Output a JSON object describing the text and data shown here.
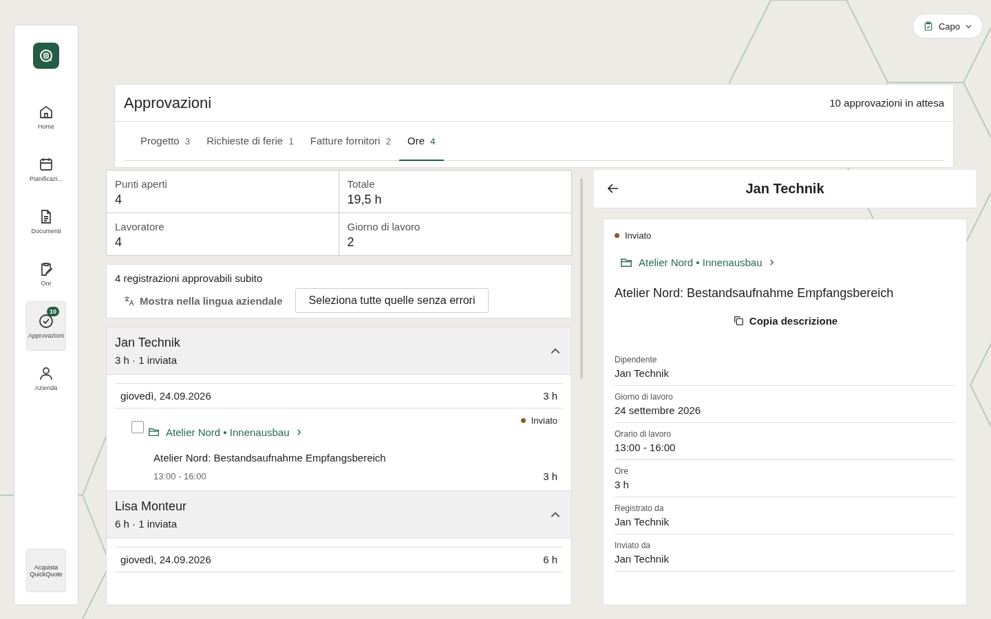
{
  "sidebar": {
    "items": [
      {
        "label": "Home",
        "kind": "home",
        "selected": false
      },
      {
        "label": "Pianificazi...",
        "kind": "calendar",
        "selected": false
      },
      {
        "label": "Documenti",
        "kind": "document",
        "selected": false
      },
      {
        "label": "Ore",
        "kind": "clipboard",
        "selected": false
      },
      {
        "label": "Approvazioni",
        "kind": "check",
        "selected": true,
        "badge": "10"
      },
      {
        "label": "Azienda",
        "kind": "person",
        "selected": false
      }
    ],
    "bottom_button": "Acquista QuickQuote"
  },
  "role_menu": {
    "label": "Capo"
  },
  "page": {
    "title": "Approvazioni",
    "pending": "10 approvazioni in attesa"
  },
  "tabs": [
    {
      "label": "Progetto",
      "count": "3",
      "selected": false
    },
    {
      "label": "Richieste di ferie",
      "count": "1",
      "selected": false
    },
    {
      "label": "Fatture fornitori",
      "count": "2",
      "selected": false
    },
    {
      "label": "Ore",
      "count": "4",
      "selected": true
    }
  ],
  "stats": [
    {
      "label": "Punti aperti",
      "value": "4"
    },
    {
      "label": "Totale",
      "value": "19,5 h"
    },
    {
      "label": "Lavoratore",
      "value": "4"
    },
    {
      "label": "Giorno di lavoro",
      "value": "2"
    }
  ],
  "bulk": {
    "summary": "4 registrazioni approvabili subito",
    "translate": "Mostra nella lingua aziendale",
    "select_all": "Seleziona tutte quelle senza errori"
  },
  "groups": [
    {
      "name": "Jan Technik",
      "summary": "3 h · 1 inviata",
      "expanded": true,
      "days": [
        {
          "date": "giovedì, 24.09.2026",
          "total": "3 h",
          "entries": [
            {
              "checked": false,
              "status": "Inviato",
              "color": "#8b5a2b",
              "project": "Atelier Nord • Innenausbau",
              "description": "Atelier Nord: Bestandsaufnahme Empfangsbereich",
              "time": "13:00 - 16:00",
              "hours": "3 h"
            }
          ]
        }
      ]
    },
    {
      "name": "Lisa Monteur",
      "summary": "6 h · 1 inviata",
      "expanded": true,
      "days": [
        {
          "date": "giovedì, 24.09.2026",
          "total": "6 h"
        }
      ]
    }
  ],
  "detail": {
    "title": "Jan Technik",
    "status": "Inviato",
    "color": "#8b5a2b",
    "project": "Atelier Nord • Innenausbau",
    "description": "Atelier Nord: Bestandsaufnahme Empfangsbereich",
    "copy": "Copia descrizione",
    "fields": [
      {
        "label": "Dipendente",
        "value": "Jan Technik"
      },
      {
        "label": "Giorno di lavoro",
        "value": "24 settembre 2026"
      },
      {
        "label": "Orario di lavoro",
        "value": "13:00 - 16:00"
      },
      {
        "label": "Ore",
        "value": "3 h"
      },
      {
        "label": "Registrato da",
        "value": "Jan Technik"
      },
      {
        "label": "Inviato da",
        "value": "Jan Technik"
      }
    ]
  }
}
